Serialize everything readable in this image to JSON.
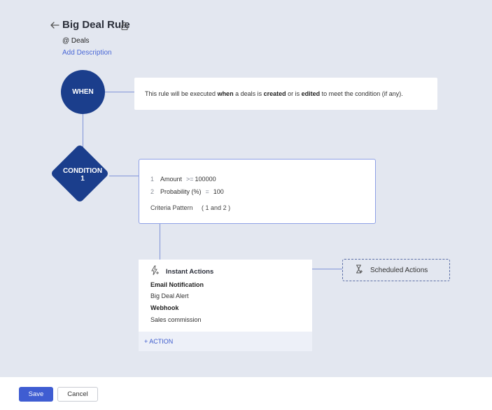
{
  "header": {
    "title": "Big Deal Rule",
    "module": "@ Deals",
    "add_description": "Add Description"
  },
  "when": {
    "label": "WHEN",
    "text_1": "This rule will be executed ",
    "text_2": "when",
    "text_3": " a deals is ",
    "text_4": "created",
    "text_5": " or is ",
    "text_6": "edited",
    "text_7": " to meet the condition (if any)."
  },
  "condition": {
    "label_line1": "CONDITION",
    "label_line2": "1",
    "criteria": [
      {
        "num": "1",
        "field": "Amount",
        "op": ">=",
        "value": "100000"
      },
      {
        "num": "2",
        "field": "Probability (%)",
        "op": "=",
        "value": "100"
      }
    ],
    "pattern_label": "Criteria Pattern",
    "pattern_value": "( 1 and 2 )"
  },
  "instant_actions": {
    "title": "Instant Actions",
    "items": [
      {
        "text": "Email Notification",
        "type": "heading"
      },
      {
        "text": "Big Deal Alert",
        "type": "value"
      },
      {
        "text": "Webhook",
        "type": "heading"
      },
      {
        "text": "Sales commission",
        "type": "value"
      }
    ],
    "add_action": "+ ACTION"
  },
  "scheduled_actions": {
    "label": "Scheduled Actions"
  },
  "footer": {
    "save": "Save",
    "cancel": "Cancel"
  },
  "colors": {
    "node": "#1b3e8c",
    "accent": "#3f5dd2",
    "link": "#4a68d6",
    "background": "#e3e7f0"
  }
}
